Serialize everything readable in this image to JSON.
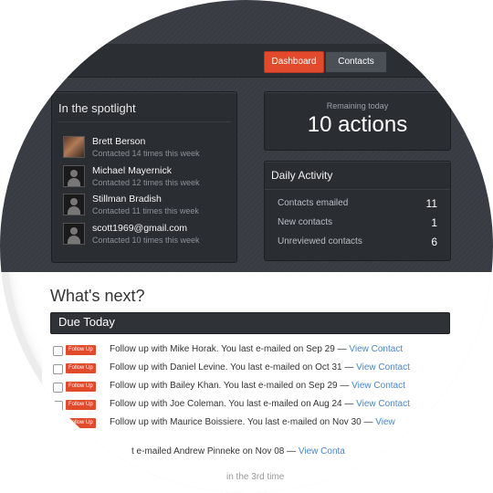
{
  "nav": {
    "tabs": [
      {
        "label": "Dashboard",
        "active": true
      },
      {
        "label": "Contacts",
        "active": false
      }
    ]
  },
  "spotlight": {
    "title": "In the spotlight",
    "people": [
      {
        "name": "Brett Berson",
        "meta": "Contacted 14 times this week",
        "avatar": "photo"
      },
      {
        "name": "Michael Mayernick",
        "meta": "Contacted 12 times this week",
        "avatar": "silhouette"
      },
      {
        "name": "Stillman Bradish",
        "meta": "Contacted 11 times this week",
        "avatar": "silhouette"
      },
      {
        "name": "scott1969@gmail.com",
        "meta": "Contacted 10 times this week",
        "avatar": "silhouette"
      }
    ]
  },
  "remaining": {
    "label": "Remaining today",
    "value": "10 actions"
  },
  "daily_activity": {
    "title": "Daily Activity",
    "stats": [
      {
        "label": "Contacts emailed",
        "value": "11"
      },
      {
        "label": "New contacts",
        "value": "1"
      },
      {
        "label": "Unreviewed contacts",
        "value": "6"
      }
    ]
  },
  "whats_next": {
    "heading": "What's next?",
    "due_today": "Due Today",
    "badge": "Follow Up",
    "items": [
      {
        "text": "Follow up with Mike Horak. You last e-mailed on Sep 29 — ",
        "link": "View Contact"
      },
      {
        "text": "Follow up with Daniel Levine. You last e-mailed on Oct 31 — ",
        "link": "View Contact"
      },
      {
        "text": "Follow up with Bailey Khan. You last e-mailed on Sep 29 — ",
        "link": "View Contact"
      },
      {
        "text": "Follow up with Joe Coleman. You last e-mailed on Aug 24 — ",
        "link": "View Contact"
      },
      {
        "text": "Follow up with Maurice Boissiere. You last e-mailed on Nov 30 — ",
        "link": "View"
      }
    ],
    "partial_line_1": {
      "text": "t e-mailed Andrew Pinneke on Nov 08 — ",
      "link": "View Conta"
    },
    "partial_line_2": "in the 3rd time"
  },
  "colors": {
    "accent": "#e14b2c",
    "dark_bg": "#3b3f45",
    "link": "#4a86c6"
  }
}
